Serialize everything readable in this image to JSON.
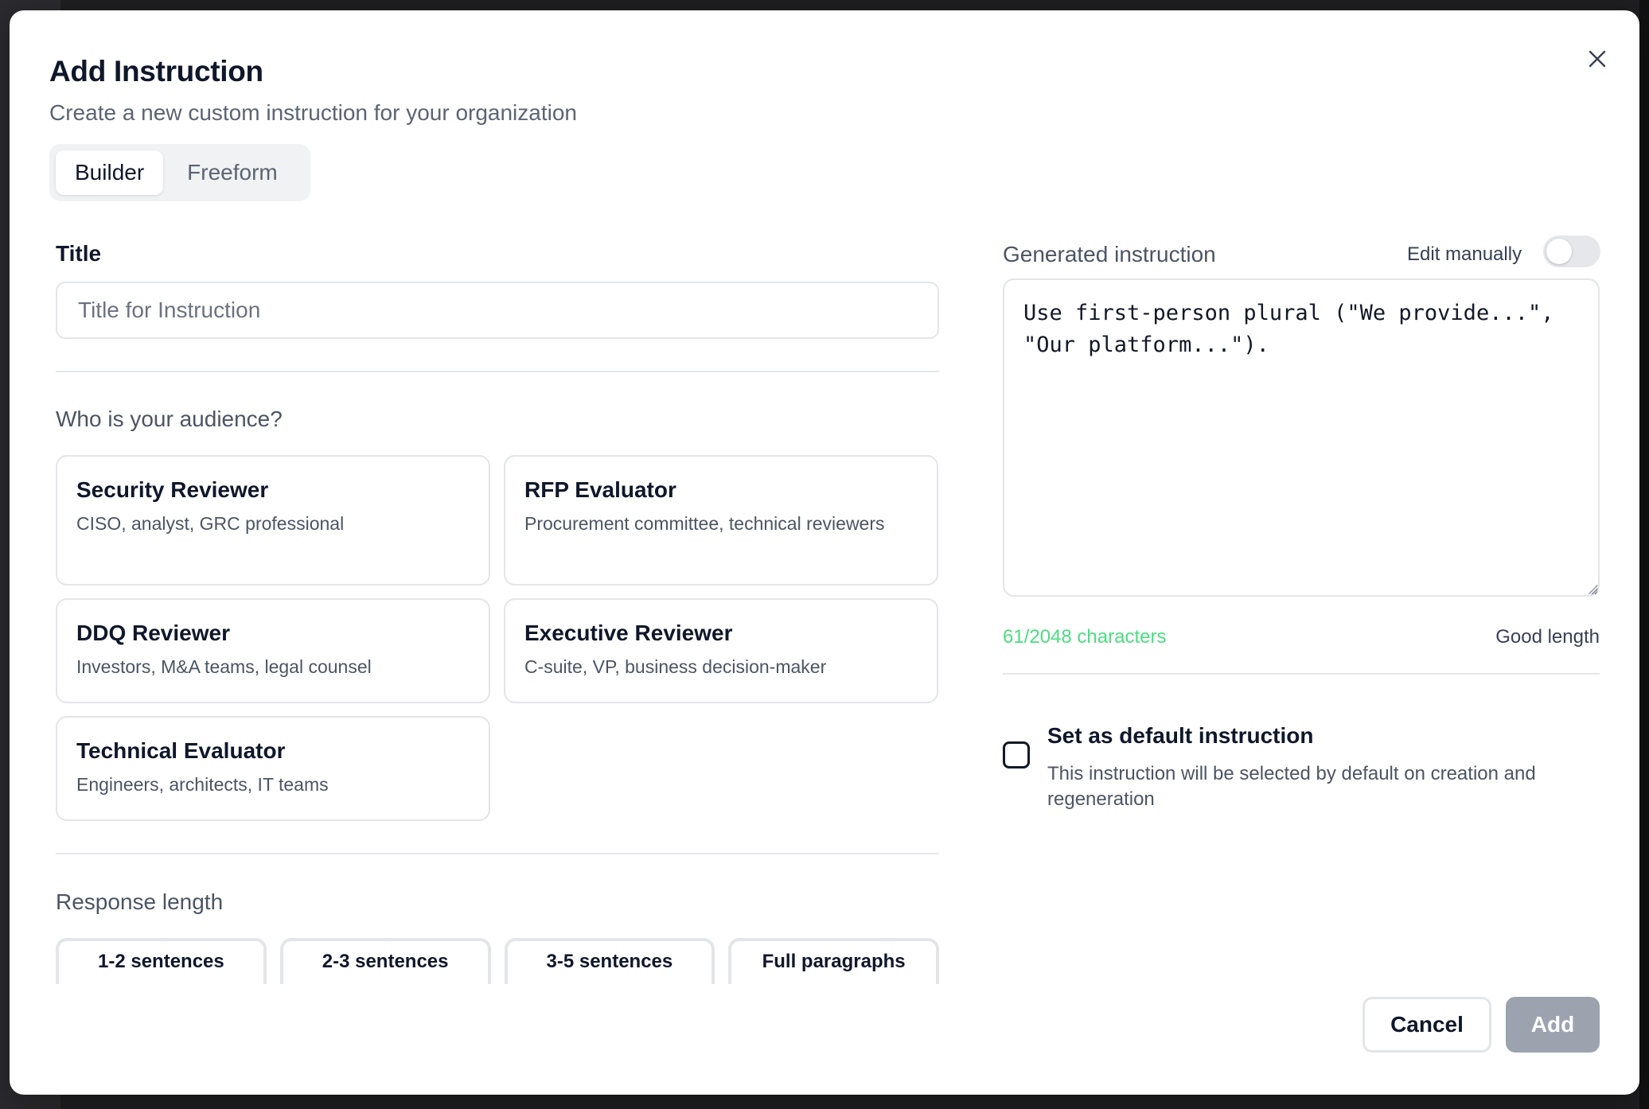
{
  "dialog": {
    "title": "Add Instruction",
    "subtitle": "Create a new custom instruction for your organization",
    "close_icon": "close-icon"
  },
  "mode_tabs": [
    {
      "label": "Builder",
      "active": true
    },
    {
      "label": "Freeform",
      "active": false
    }
  ],
  "title_field": {
    "label": "Title",
    "placeholder": "Title for Instruction",
    "value": ""
  },
  "audience": {
    "heading": "Who is your audience?",
    "options": [
      {
        "title": "Security Reviewer",
        "description": "CISO, analyst, GRC professional"
      },
      {
        "title": "RFP Evaluator",
        "description": "Procurement committee, technical reviewers"
      },
      {
        "title": "DDQ Reviewer",
        "description": "Investors, M&A teams, legal counsel"
      },
      {
        "title": "Executive Reviewer",
        "description": "C-suite, VP, business decision-maker"
      },
      {
        "title": "Technical Evaluator",
        "description": "Engineers, architects, IT teams"
      }
    ]
  },
  "response_length": {
    "heading": "Response length",
    "options": [
      "1-2 sentences",
      "2-3 sentences",
      "3-5 sentences",
      "Full paragraphs"
    ]
  },
  "generated": {
    "label": "Generated instruction",
    "edit_manually_label": "Edit manually",
    "edit_manually_on": false,
    "text": "Use first-person plural (\"We provide...\", \"Our platform...\").",
    "char_count": "61/2048 characters",
    "length_status": "Good length"
  },
  "default_option": {
    "title": "Set as default instruction",
    "description": "This instruction will be selected by default on creation and regeneration",
    "checked": false
  },
  "footer": {
    "cancel_label": "Cancel",
    "add_label": "Add"
  },
  "colors": {
    "accent_disabled": "#9ca3af",
    "char_count_good": "#4ade80"
  }
}
